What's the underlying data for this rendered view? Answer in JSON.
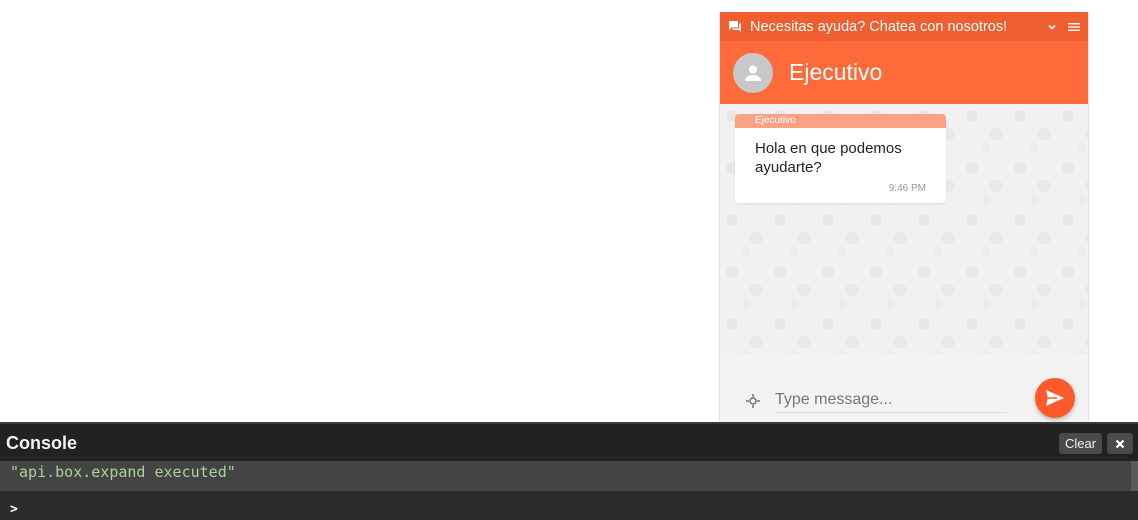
{
  "chat": {
    "header_title": "Necesitas ayuda? Chatea con nosotros!",
    "agent_name": "Ejecutivo",
    "messages": [
      {
        "sender": "Ejecutivo",
        "text": "Hola en que podemos ayudarte?",
        "time": "9:46 PM"
      }
    ],
    "input_placeholder": "Type message...",
    "icons": {
      "header": "chat-bubbles-icon",
      "collapse": "chevron-down-icon",
      "menu": "hamburger-menu-icon",
      "avatar": "user-icon",
      "attach": "attach-icon",
      "send": "send-icon"
    }
  },
  "console": {
    "title": "Console",
    "clear_label": "Clear",
    "log_lines": [
      "\"api.box.expand executed\""
    ],
    "prompt_symbol": ">"
  },
  "colors": {
    "header_orange": "#ee5e2e",
    "agent_bar_orange": "#ff6a3b",
    "sender_label": "#fba184",
    "send_button": "#ff5a2c",
    "console_bg": "#2b2b2b",
    "log_text": "#a9d39a"
  }
}
